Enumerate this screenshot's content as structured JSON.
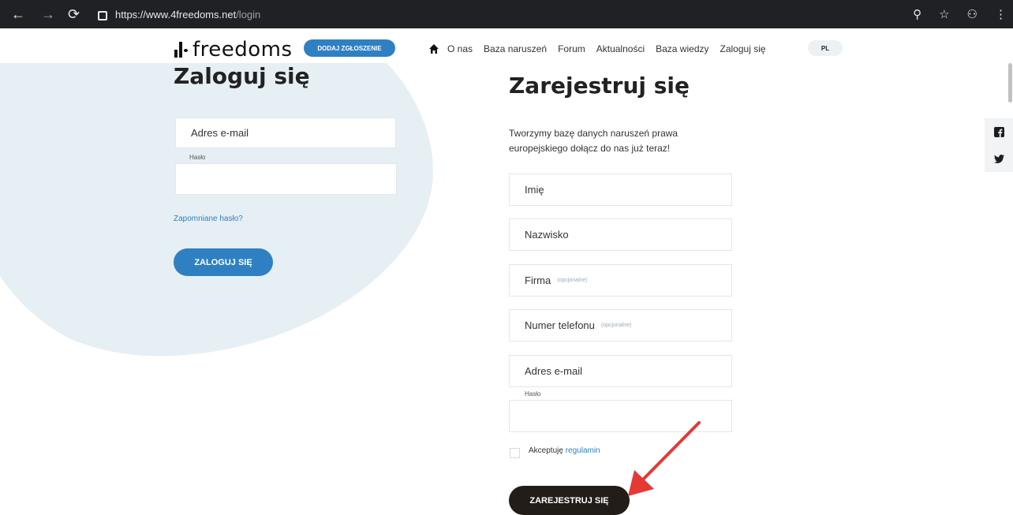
{
  "browser": {
    "url_host": "https://www.4freedoms.net",
    "url_path": "/login"
  },
  "header": {
    "brand": "freedoms",
    "report_button": "DODAJ ZGŁOSZENIE",
    "nav": [
      "O nas",
      "Baza naruszeń",
      "Forum",
      "Aktualności",
      "Baza wiedzy",
      "Zaloguj się"
    ],
    "lang": "PL"
  },
  "login": {
    "title": "Zaloguj się",
    "email_label": "Adres e-mail",
    "password_label": "Hasło",
    "forgot": "Zapomniane hasło?",
    "submit": "ZALOGUJ SIĘ"
  },
  "register": {
    "title": "Zarejestruj się",
    "description": "Tworzymy bazę danych naruszeń prawa europejskiego dołącz do nas już teraz!",
    "first_name": "Imię",
    "last_name": "Nazwisko",
    "company": "Firma",
    "company_optional": "(opcjonalne)",
    "phone": "Numer telefonu",
    "phone_optional": "(opcjonalne)",
    "email": "Adres e-mail",
    "password_label": "Hasło",
    "accept_text": "Akceptuję",
    "accept_link": "regulamin",
    "submit": "ZAREJESTRUJ SIĘ"
  },
  "colors": {
    "accent": "#2f80c2",
    "dark_button": "#231d1a",
    "blob": "#e6eff3",
    "annotation_arrow": "#e53935"
  }
}
